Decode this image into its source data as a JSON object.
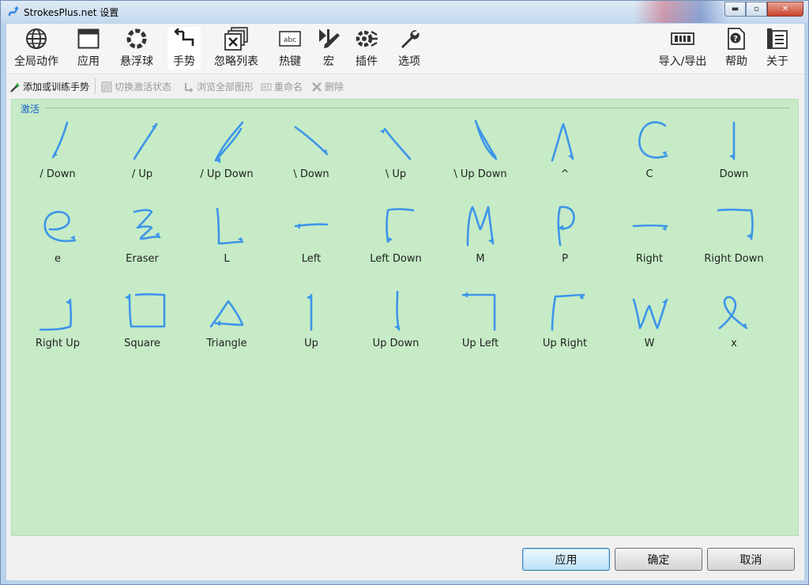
{
  "window": {
    "title": "StrokesPlus.net 设置",
    "controls": {
      "minimize": "▬",
      "maximize": "▫",
      "close": "✕"
    }
  },
  "toolbar": {
    "left": [
      {
        "label": "全局动作",
        "icon": "globe-icon"
      },
      {
        "label": "应用",
        "icon": "window-icon"
      },
      {
        "label": "悬浮球",
        "icon": "gear-icon"
      },
      {
        "label": "手势",
        "icon": "gesture-icon",
        "active": true
      },
      {
        "label": "忽略列表",
        "icon": "ignore-list-icon"
      },
      {
        "label": "热键",
        "icon": "keyboard-icon"
      },
      {
        "label": "宏",
        "icon": "macro-icon"
      },
      {
        "label": "插件",
        "icon": "plugin-icon"
      },
      {
        "label": "选项",
        "icon": "wrench-icon"
      }
    ],
    "right": [
      {
        "label": "导入/导出",
        "icon": "import-export-icon"
      },
      {
        "label": "帮助",
        "icon": "help-icon"
      },
      {
        "label": "关于",
        "icon": "about-icon"
      }
    ]
  },
  "actions": {
    "add": "添加或训练手势",
    "toggle": "切换激活状态",
    "browse": "浏览全部图形",
    "rename": "重命名",
    "delete": "删除"
  },
  "group": {
    "label": "激活"
  },
  "gestures": [
    "/ Down",
    "/ Up",
    "/ Up Down",
    "\\ Down",
    "\\ Up",
    "\\ Up Down",
    "^",
    "C",
    "Down",
    "e",
    "Eraser",
    "L",
    "Left",
    "Left Down",
    "M",
    "P",
    "Right",
    "Right Down",
    "Right Up",
    "Square",
    "Triangle",
    "Up",
    "Up Down",
    "Up Left",
    "Up Right",
    "W",
    "x"
  ],
  "colors": {
    "stroke": "#3d95ea",
    "panel": "#c6ebc6",
    "group_label": "#1a5ec7"
  },
  "buttons": {
    "apply": "应用",
    "ok": "确定",
    "cancel": "取消"
  }
}
